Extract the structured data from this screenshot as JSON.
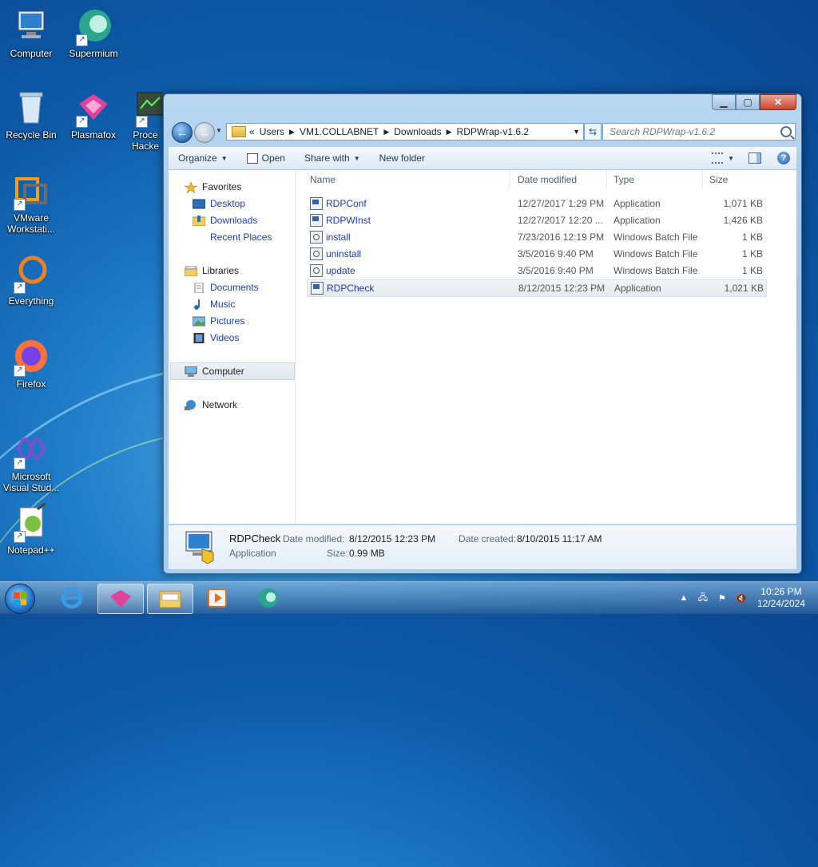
{
  "desktop": {
    "icons": [
      {
        "label": "Computer"
      },
      {
        "label": "Supermium"
      },
      {
        "label": "Recycle Bin"
      },
      {
        "label": "Plasmafox"
      },
      {
        "label": "Proce Hacke"
      },
      {
        "label": "VMware Workstati..."
      },
      {
        "label": "Everything"
      },
      {
        "label": "Firefox"
      },
      {
        "label": "Microsoft Visual Stud..."
      },
      {
        "label": "Notepad++"
      }
    ]
  },
  "window": {
    "address": {
      "prefix": "«",
      "crumbs": [
        "Users",
        "VM1.COLLABNET",
        "Downloads",
        "RDPWrap-v1.6.2"
      ]
    },
    "search_placeholder": "Search RDPWrap-v1.6.2",
    "toolbar": {
      "organize": "Organize",
      "open": "Open",
      "share_with": "Share with",
      "new_folder": "New folder"
    },
    "nav": {
      "favorites": "Favorites",
      "desktop": "Desktop",
      "downloads": "Downloads",
      "recent_places": "Recent Places",
      "libraries": "Libraries",
      "documents": "Documents",
      "music": "Music",
      "pictures": "Pictures",
      "videos": "Videos",
      "computer": "Computer",
      "network": "Network"
    },
    "columns": {
      "name": "Name",
      "date_modified": "Date modified",
      "type": "Type",
      "size": "Size"
    },
    "files": [
      {
        "name": "RDPConf",
        "date": "12/27/2017 1:29 PM",
        "type": "Application",
        "size": "1,071 KB",
        "kind": "app"
      },
      {
        "name": "RDPWInst",
        "date": "12/27/2017 12:20 ...",
        "type": "Application",
        "size": "1,426 KB",
        "kind": "app"
      },
      {
        "name": "install",
        "date": "7/23/2016 12:19 PM",
        "type": "Windows Batch File",
        "size": "1 KB",
        "kind": "bat"
      },
      {
        "name": "uninstall",
        "date": "3/5/2016 9:40 PM",
        "type": "Windows Batch File",
        "size": "1 KB",
        "kind": "bat"
      },
      {
        "name": "update",
        "date": "3/5/2016 9:40 PM",
        "type": "Windows Batch File",
        "size": "1 KB",
        "kind": "bat"
      },
      {
        "name": "RDPCheck",
        "date": "8/12/2015 12:23 PM",
        "type": "Application",
        "size": "1,021 KB",
        "kind": "app"
      }
    ],
    "details": {
      "name": "RDPCheck",
      "type": "Application",
      "date_modified_label": "Date modified:",
      "date_modified": "8/12/2015 12:23 PM",
      "date_created_label": "Date created:",
      "date_created": "8/10/2015 11:17 AM",
      "size_label": "Size:",
      "size": "0.99 MB"
    }
  },
  "taskbar": {
    "time": "10:26 PM",
    "date": "12/24/2024"
  }
}
